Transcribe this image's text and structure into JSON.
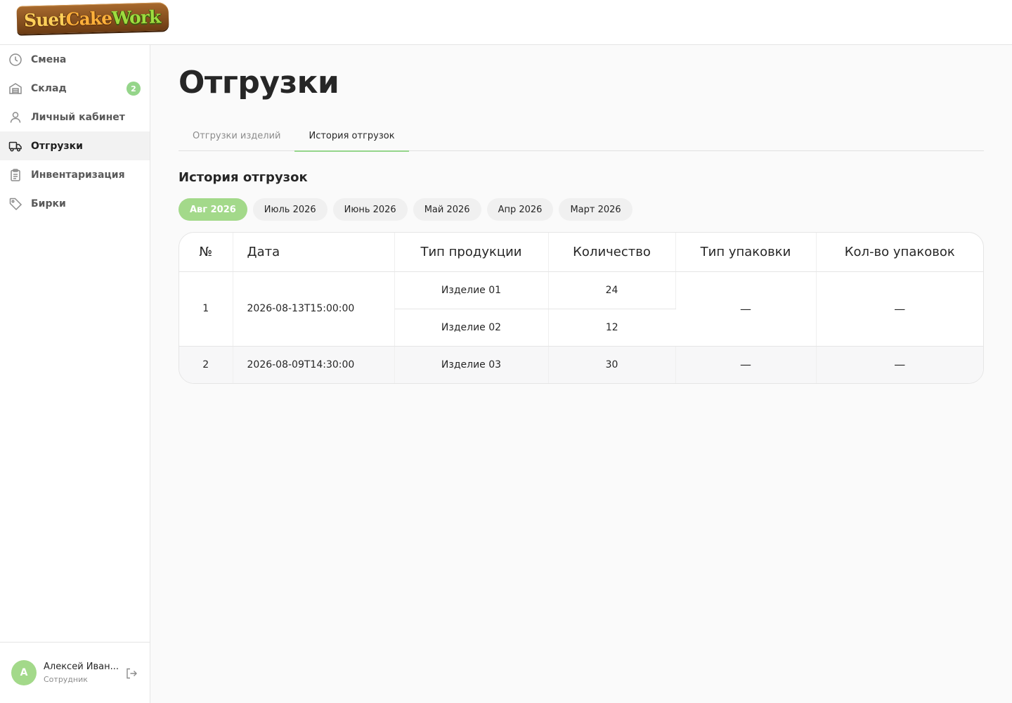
{
  "brand": {
    "logo_text_1": "Suet",
    "logo_text_2": "Cake",
    "logo_text_3": "Work",
    "colors": {
      "accent": "#95d58a",
      "logo_wood": "#8b521f"
    }
  },
  "sidebar": {
    "items": [
      {
        "label": "Смена",
        "icon": "clock-icon"
      },
      {
        "label": "Склад",
        "icon": "warehouse-icon",
        "badge": "2"
      },
      {
        "label": "Личный кабинет",
        "icon": "user-icon"
      },
      {
        "label": "Отгрузки",
        "icon": "truck-icon",
        "active": true
      },
      {
        "label": "Инвентаризация",
        "icon": "clipboard-icon"
      },
      {
        "label": "Бирки",
        "icon": "tag-icon"
      }
    ]
  },
  "user": {
    "initial": "А",
    "name": "Алексей Иван...",
    "role": "Сотрудник",
    "logout_icon": "logout-icon"
  },
  "page": {
    "title": "Отгрузки",
    "tabs": [
      "Отгрузки изделий",
      "История отгрузок"
    ],
    "active_tab": 1,
    "section_title": "История отгрузок",
    "months": [
      "Авг 2026",
      "Июль 2026",
      "Июнь 2026",
      "Май 2026",
      "Апр 2026",
      "Март 2026"
    ],
    "active_month": 0
  },
  "table": {
    "headers": [
      "№",
      "Дата",
      "Тип продукции",
      "Количество",
      "Тип упаковки",
      "Кол-во упаковок"
    ],
    "rows": [
      {
        "num": "1",
        "date": "2026-08-13T15:00:00",
        "items": [
          {
            "product": "Изделие 01",
            "qty": "24"
          },
          {
            "product": "Изделие 02",
            "qty": "12"
          }
        ],
        "pack_type": "—",
        "pack_count": "—"
      },
      {
        "num": "2",
        "date": "2026-08-09T14:30:00",
        "items": [
          {
            "product": "Изделие 03",
            "qty": "30"
          }
        ],
        "pack_type": "—",
        "pack_count": "—"
      }
    ]
  }
}
